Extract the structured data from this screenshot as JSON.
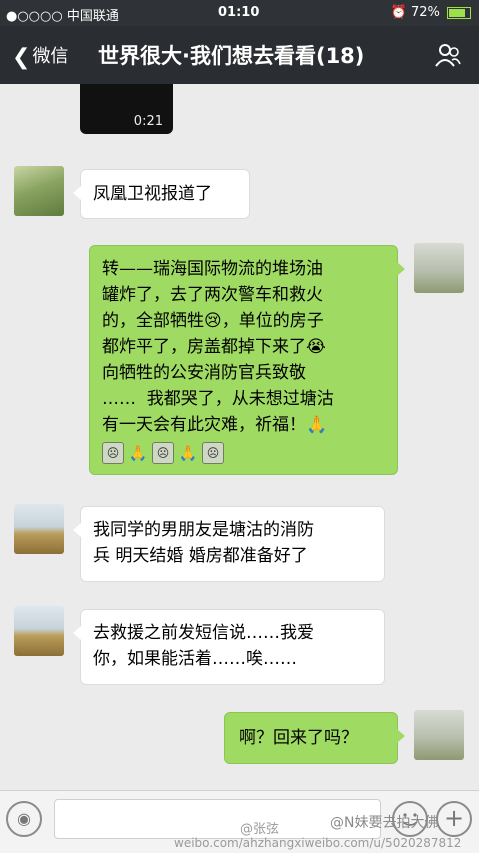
{
  "status_bar": {
    "carrier": "●○○○○ 中国联通",
    "time": "01:10",
    "battery": "72%"
  },
  "nav": {
    "back_label": "微信",
    "title": "世界很大·我们想去看看(18)"
  },
  "video": {
    "duration": "0:21"
  },
  "messages": [
    {
      "side": "left",
      "text": "凤凰卫视报道了"
    },
    {
      "side": "right",
      "text": "转——瑞海国际物流的堆场油\n罐炸了，去了两次警车和救火\n的，全部牺牲😢，单位的房子\n都炸平了，房盖都掉下来了😭\n向牺牲的公安消防官兵致敬\n……  我都哭了，从未想过塘沽\n有一天会有此灾难，祈福！🙏"
    },
    {
      "side": "left",
      "text": "我同学的男朋友是塘沽的消防\n兵 明天结婚 婚房都准备好了"
    },
    {
      "side": "left",
      "text": "去救援之前发短信说……我爱\n你，如果能活着……唉……"
    },
    {
      "side": "right",
      "text": "啊？回来了吗？"
    }
  ],
  "emoji_row": [
    "face",
    "pray",
    "face",
    "pray",
    "face"
  ],
  "watermark": {
    "name": "@张弦",
    "handle": "@N妹要去拍大佛",
    "url": "weibo.com/ahzhangxiweibo.com/u/5020287812"
  },
  "colors": {
    "nav_bg": "#2a2d31",
    "chat_bg": "#ebebeb",
    "green_bubble": "#9fdb62",
    "white_bubble": "#ffffff"
  },
  "icons": [
    "back-chevron-icon",
    "contact-icon",
    "voice-icon",
    "emoji-icon",
    "plus-icon",
    "wifi-icon",
    "alarm-icon",
    "battery-icon"
  ]
}
